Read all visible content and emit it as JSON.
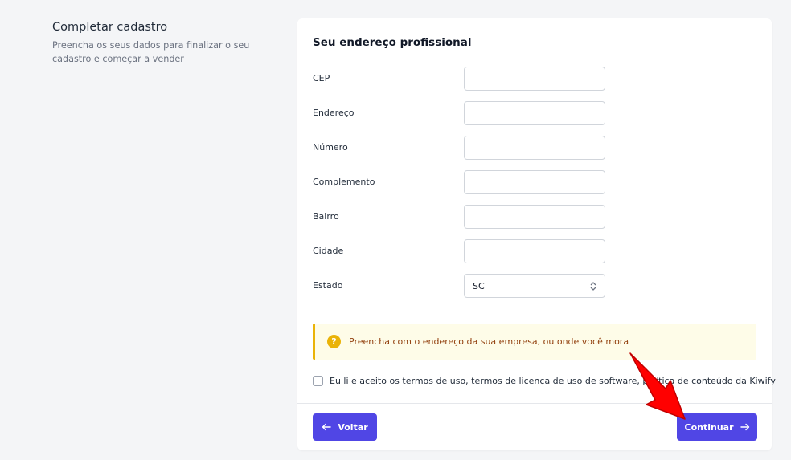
{
  "intro": {
    "title": "Completar cadastro",
    "subtitle": "Preencha os seus dados para finalizar o seu cadastro e começar a vender"
  },
  "form": {
    "title": "Seu endereço profissional",
    "fields": [
      {
        "label": "CEP",
        "value": ""
      },
      {
        "label": "Endereço",
        "value": ""
      },
      {
        "label": "Número",
        "value": ""
      },
      {
        "label": "Complemento",
        "value": ""
      },
      {
        "label": "Bairro",
        "value": ""
      },
      {
        "label": "Cidade",
        "value": ""
      }
    ],
    "estado": {
      "label": "Estado",
      "value": "SC"
    }
  },
  "alert": {
    "icon": "question-circle-icon",
    "text": "Preencha com o endereço da sua empresa, ou onde você mora"
  },
  "terms": {
    "prefix": "Eu li e aceito os",
    "link1": "termos de uso",
    "sep1": ",",
    "link2": "termos de licença de uso de software",
    "sep2": ",",
    "link3": "política de conteúdo",
    "suffix": "da Kiwify"
  },
  "buttons": {
    "back_label": "Voltar",
    "next_label": "Continuar"
  },
  "colors": {
    "primary": "#5046e5",
    "alert_bg": "#fefce8",
    "alert_accent": "#eab308",
    "annotation": "#ff0000"
  }
}
